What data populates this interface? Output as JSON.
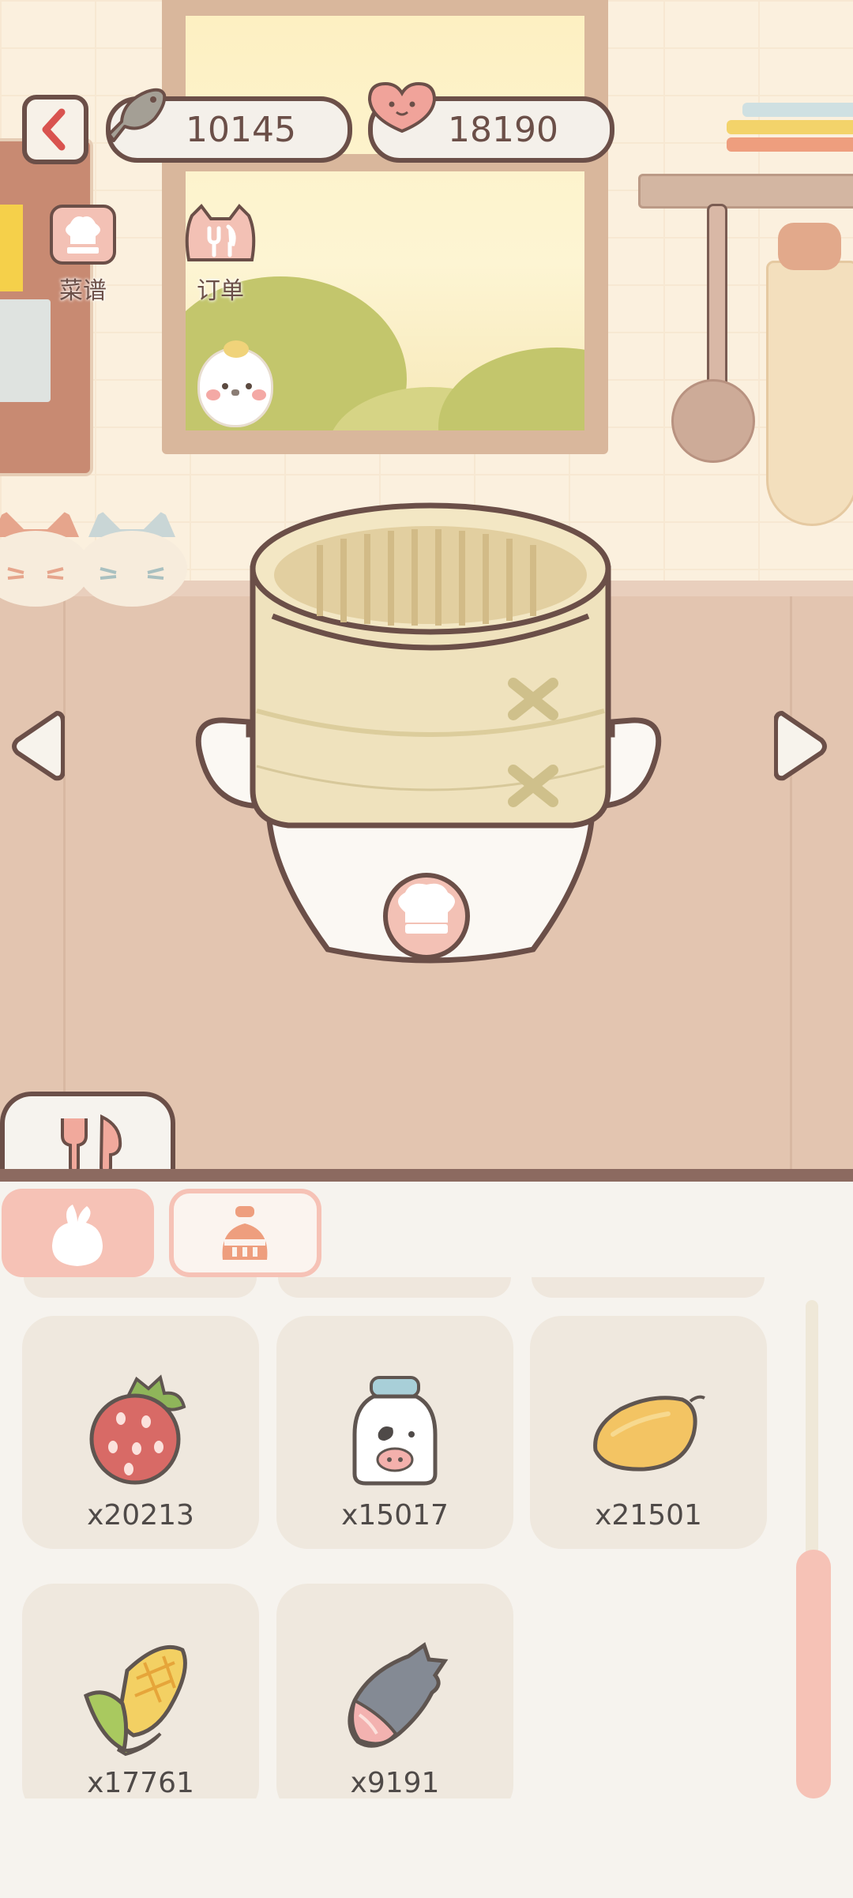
{
  "currency": {
    "fish": "10145",
    "hearts": "18190"
  },
  "menu": {
    "recipes_label": "菜谱",
    "orders_label": "订单"
  },
  "inventory": {
    "items": [
      {
        "name": "strawberry",
        "count": "x20213"
      },
      {
        "name": "milk-bottle",
        "count": "x15017"
      },
      {
        "name": "mango",
        "count": "x21501"
      },
      {
        "name": "corn",
        "count": "x17761"
      },
      {
        "name": "fish-steak",
        "count": "x9191"
      }
    ],
    "scroll_position": 1.0
  },
  "colors": {
    "accent": "#f6c2b6",
    "outline": "#6b4f48",
    "counter": "#e3c5b0"
  }
}
